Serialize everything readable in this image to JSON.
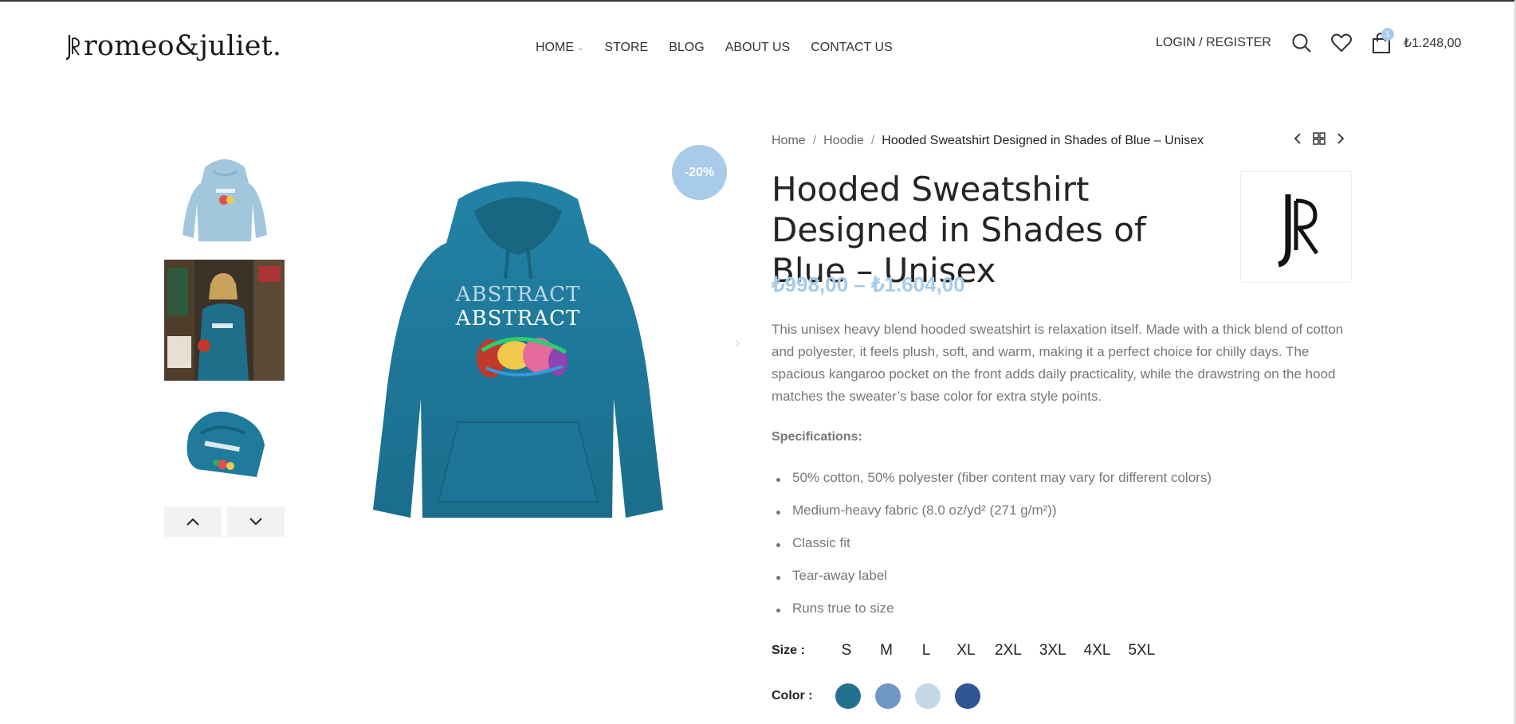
{
  "header": {
    "logo_text": "romeo&juliet.",
    "nav": [
      {
        "label": "HOME",
        "has_dropdown": true
      },
      {
        "label": "STORE"
      },
      {
        "label": "BLOG"
      },
      {
        "label": "ABOUT US"
      },
      {
        "label": "CONTACT US"
      }
    ],
    "login_label": "LOGIN / REGISTER",
    "cart_count": "1",
    "cart_total": "₺1.248,00",
    "icons": [
      "search-icon",
      "heart-icon",
      "shopping-bag-icon"
    ]
  },
  "gallery": {
    "discount_badge": "-20%",
    "thumbs": [
      "hoodie-light-blue",
      "model-in-street",
      "folded-hoodie"
    ],
    "hoodie_print_text": "ABSTRACT",
    "colors": {
      "hoodie": "#1f7a9c",
      "light_hoodie": "#a2c7dc",
      "badge": "#a7cbe8"
    }
  },
  "product": {
    "breadcrumb": {
      "home": "Home",
      "category": "Hoodie",
      "current": "Hooded Sweatshirt Designed in Shades of Blue – Unisex"
    },
    "title": "Hooded Sweatshirt Designed in Shades of Blue – Unisex",
    "price": "₺998,00 – ₺1.604,00",
    "description": "This unisex heavy blend hooded sweatshirt is relaxation itself. Made with a thick blend of cotton and polyester, it feels plush, soft, and warm, making it a perfect choice for chilly days. The spacious kangaroo pocket on the front adds daily practicality, while the drawstring on the hood matches the sweater’s base color for extra style points.",
    "spec_title": "Specifications:",
    "specs": [
      "50% cotton, 50% polyester (fiber content may vary for different colors)",
      "Medium-heavy fabric (8.0 oz/yd² (271 g/m²))",
      "Classic fit",
      "Tear-away label",
      "Runs true to size"
    ],
    "size_label": "Size :",
    "sizes": [
      "S",
      "M",
      "L",
      "XL",
      "2XL",
      "3XL",
      "4XL",
      "5XL"
    ],
    "color_label": "Color :",
    "swatches": [
      "#23708f",
      "#7096c6",
      "#c3d9ea",
      "#2f5594"
    ]
  }
}
